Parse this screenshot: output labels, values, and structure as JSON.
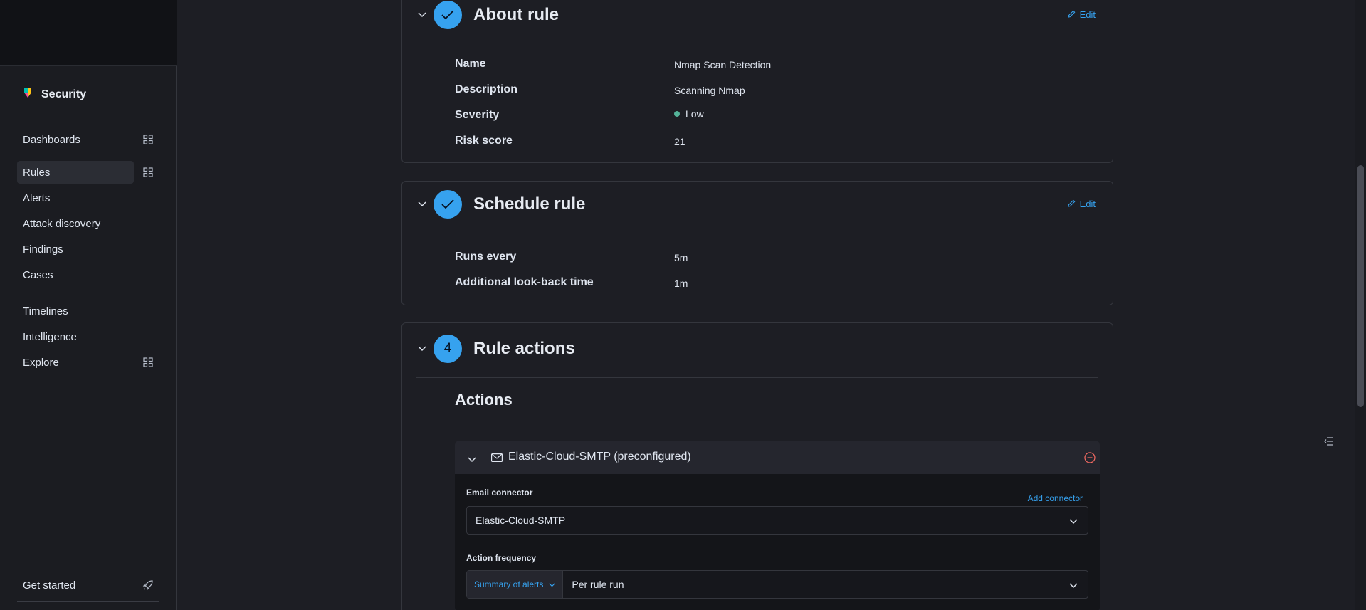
{
  "sidebar": {
    "app_label": "Security",
    "items": [
      {
        "label": "Dashboards",
        "icon": "apps-grid-icon"
      },
      {
        "label": "Rules",
        "icon": "apps-grid-icon",
        "active": true
      },
      {
        "label": "Alerts"
      },
      {
        "label": "Attack discovery"
      },
      {
        "label": "Findings"
      },
      {
        "label": "Cases"
      },
      {
        "label": "Timelines"
      },
      {
        "label": "Intelligence"
      },
      {
        "label": "Explore",
        "icon": "apps-grid-icon"
      }
    ],
    "footer": {
      "label": "Get started",
      "icon": "rocket-icon"
    }
  },
  "about_rule": {
    "title": "About rule",
    "edit_label": "Edit",
    "fields": [
      {
        "label": "Name",
        "value": "Nmap Scan Detection"
      },
      {
        "label": "Description",
        "value": "Scanning Nmap"
      },
      {
        "label": "Severity",
        "value": "Low"
      },
      {
        "label": "Risk score",
        "value": "21"
      }
    ]
  },
  "schedule_rule": {
    "title": "Schedule rule",
    "edit_label": "Edit",
    "fields": [
      {
        "label": "Runs every",
        "value": "5m"
      },
      {
        "label": "Additional look-back time",
        "value": "1m"
      }
    ]
  },
  "rule_actions": {
    "step_number": "4",
    "title": "Rule actions",
    "actions_heading": "Actions",
    "action": {
      "connector_title": "Elastic-Cloud-SMTP (preconfigured)",
      "email_connector_label": "Email connector",
      "add_connector_label": "Add connector",
      "email_connector_value": "Elastic-Cloud-SMTP",
      "action_frequency_label": "Action frequency",
      "frequency_mode": "Summary of alerts",
      "frequency_value": "Per rule run"
    }
  },
  "colors": {
    "accent": "#36a2ef",
    "severity_low": "#54b399",
    "danger": "#f86b63"
  }
}
